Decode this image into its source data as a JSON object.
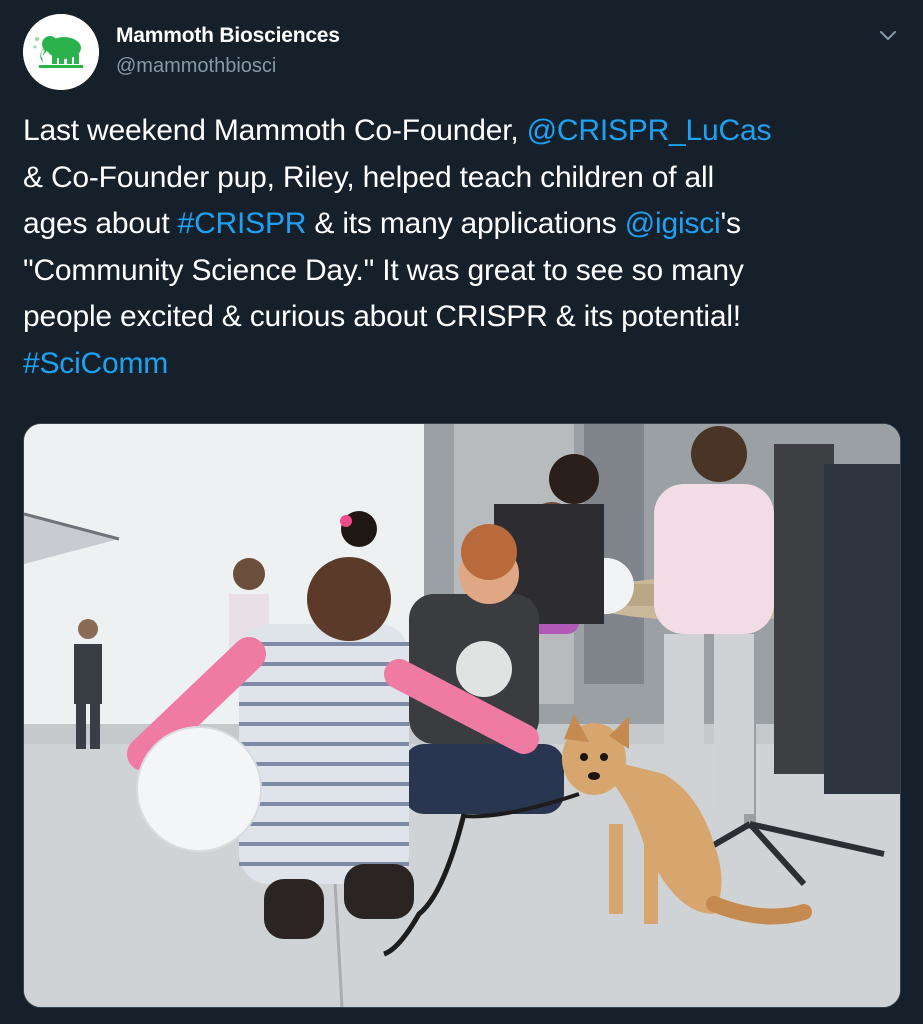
{
  "tweet": {
    "author": {
      "name": "Mammoth Biosciences",
      "handle": "@mammothbiosci",
      "avatar_icon": "mammoth-logo-icon"
    },
    "menu_icon": "chevron-down-icon",
    "text": {
      "l1_a": "Last weekend Mammoth Co-Founder, ",
      "mention_lucas": "@CRISPR_LuCas",
      "l2": " & Co-Founder pup, Riley, helped teach children of all",
      "l3_a": "ages about ",
      "hashtag_crispr": "#CRISPR",
      "l3_b": " & its many applications ",
      "mention_igisci": "@igisci",
      "l3_c": "'s",
      "l4": "\"Community Science Day.\" It was great to see so many",
      "l5": "people excited & curious about CRISPR & its potential!",
      "hashtag_scicomm": "#SciComm"
    },
    "media": {
      "description_icon": "photo"
    }
  },
  "colors": {
    "background": "#15202b",
    "link": "#1da1f2",
    "secondary_text": "#8899a6",
    "logo_green": "#2bb24c"
  }
}
